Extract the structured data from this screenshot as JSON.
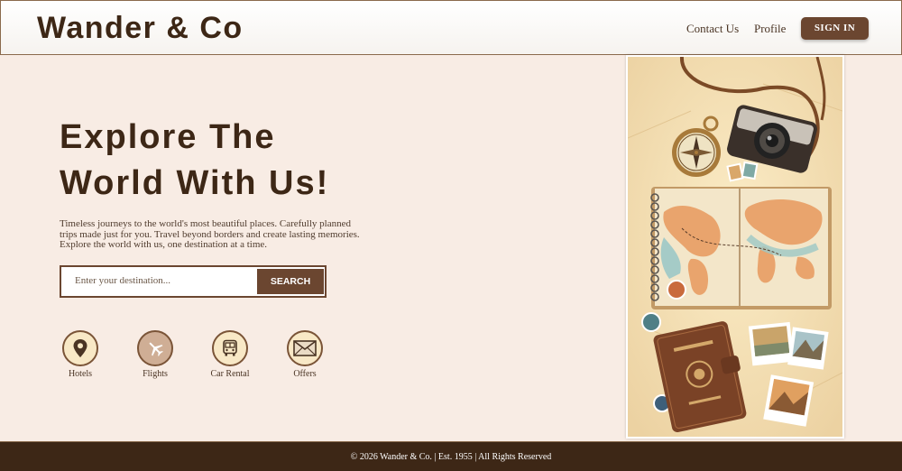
{
  "header": {
    "logo": "Wander & Co",
    "nav": {
      "contact": "Contact Us",
      "profile": "Profile"
    },
    "signin_label": "SIGN IN"
  },
  "hero": {
    "title_line1": "Explore The",
    "title_line2": "World With Us!",
    "description": "Timeless journeys to the world's most beautiful places. Carefully planned trips made just for you. Travel beyond borders and create lasting memories. Explore the world with us, one destination at a time."
  },
  "search": {
    "placeholder": "Enter your destination...",
    "value": "",
    "button_label": "SEARCH"
  },
  "categories": [
    {
      "label": "Hotels",
      "icon": "location-pin-icon"
    },
    {
      "label": "Flights",
      "icon": "airplane-icon"
    },
    {
      "label": "Car Rental",
      "icon": "bus-icon"
    },
    {
      "label": "Offers",
      "icon": "envelope-icon"
    }
  ],
  "footer": {
    "text": "© 2026 Wander & Co. | Est. 1955 | All Rights Reserved"
  },
  "colors": {
    "background": "#f8ece4",
    "brand_brown": "#6b4630",
    "dark_brown": "#3d2716"
  }
}
